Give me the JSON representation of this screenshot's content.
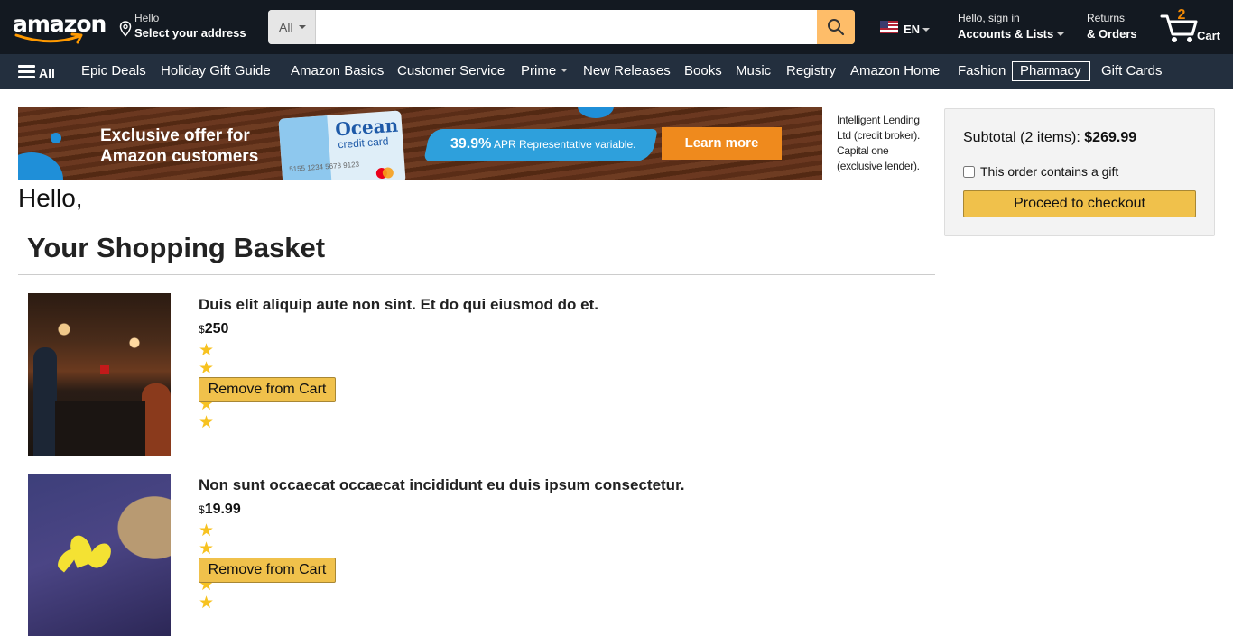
{
  "header": {
    "logo": "amazon",
    "address_line1": "Hello",
    "address_line2": "Select your address",
    "search_category": "All",
    "search_placeholder": "",
    "language": "EN",
    "account_line1": "Hello, sign in",
    "account_line2": "Accounts & Lists",
    "returns_line1": "Returns",
    "returns_line2": "& Orders",
    "cart_count": "2",
    "cart_label": "Cart"
  },
  "subnav": {
    "all_label": "All",
    "items": [
      "Epic Deals",
      "Holiday Gift Guide",
      "Amazon Basics",
      "Customer Service",
      "Prime",
      "New Releases",
      "Books",
      "Music",
      "Registry",
      "Amazon Home",
      "Fashion",
      "Pharmacy",
      "Gift Cards"
    ]
  },
  "banner": {
    "headline_line1": "Exclusive offer for",
    "headline_line2": "Amazon customers",
    "card_brand_line1": "Ocean",
    "card_brand_line2": "credit card",
    "card_number": "5155 1234 5678 9123",
    "apr_rate": "39.9%",
    "apr_text": "APR Representative variable.",
    "cta": "Learn more",
    "side_text": "Intelligent Lending Ltd (credit broker). Capital one (exclusive lender)."
  },
  "basket": {
    "greeting": "Hello,",
    "title": "Your Shopping Basket",
    "items": [
      {
        "title": "Duis elit aliquip aute non sint. Et do qui eiusmod do et.",
        "currency": "$",
        "price": "250",
        "rating": 5,
        "remove_label": "Remove from Cart"
      },
      {
        "title": "Non sunt occaecat occaecat incididunt eu duis ipsum consectetur.",
        "currency": "$",
        "price": "19.99",
        "rating": 5,
        "remove_label": "Remove from Cart"
      }
    ]
  },
  "subtotal": {
    "label": "Subtotal (2 items):",
    "amount": "$269.99",
    "gift_label": "This order contains a gift",
    "gift_checked": false,
    "checkout_label": "Proceed to checkout"
  },
  "colors": {
    "nav_top": "#131921",
    "nav_sub": "#232f3e",
    "search_button": "#febd69",
    "button_yellow": "#f0c14b",
    "star": "#f7c220",
    "cart_count": "#f08804"
  }
}
